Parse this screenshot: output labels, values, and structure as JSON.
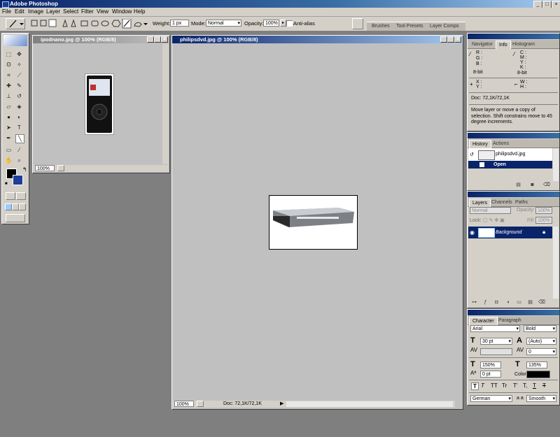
{
  "app": {
    "title": "Adobe Photoshop"
  },
  "menu": [
    "File",
    "Edit",
    "Image",
    "Layer",
    "Select",
    "Filter",
    "View",
    "Window",
    "Help"
  ],
  "options": {
    "weight_label": "Weight:",
    "weight_value": "1 px",
    "mode_label": "Mode:",
    "mode_value": "Normal",
    "opacity_label": "Opacity:",
    "opacity_value": "100%",
    "antialias_label": "Anti-alias",
    "palette_tabs": [
      "Brushes",
      "Tool Presets",
      "Layer Comps"
    ]
  },
  "documents": [
    {
      "title": "ipodnano.jpg @ 100% (RGB/8)",
      "zoom": "100%"
    },
    {
      "title": "philipsdvd.jpg @ 100% (RGB/8)",
      "zoom": "100%",
      "doc_info": "Doc: 72,1K/72,1K"
    }
  ],
  "info_panel": {
    "tabs": [
      "Navigator",
      "Info",
      "Histogram"
    ],
    "rgb_labels": [
      "R :",
      "G :",
      "B :"
    ],
    "cmyk_labels": [
      "C :",
      "M :",
      "Y :",
      "K :"
    ],
    "bitdepth_left": "8-bit",
    "bitdepth_right": "8-bit",
    "xy_labels": [
      "X :",
      "Y :"
    ],
    "wh_labels": [
      "W :",
      "H :"
    ],
    "doc": "Doc: 72,1K/72,1K",
    "hint": "Move layer or move a copy of selection. Shift constrains move to 45 degree increments."
  },
  "history_panel": {
    "tabs": [
      "History",
      "Actions"
    ],
    "snapshot": "philipsdvd.jpg",
    "states": [
      "Open"
    ]
  },
  "layers_panel": {
    "tabs": [
      "Layers",
      "Channels",
      "Paths"
    ],
    "blend_mode": "Normal",
    "opacity_label": "Opacity:",
    "opacity_value": "100%",
    "lock_label": "Lock:",
    "fill_label": "Fill:",
    "fill_value": "100%",
    "layers": [
      "Background"
    ]
  },
  "character_panel": {
    "tabs": [
      "Character",
      "Paragraph"
    ],
    "font": "Arial",
    "style": "Bold",
    "size": "30 pt",
    "leading": "(Auto)",
    "kerning": "",
    "tracking": "0",
    "vscale": "150%",
    "hscale": "135%",
    "baseline": "0 pt",
    "color_label": "Color:",
    "type_buttons": [
      "T",
      "T",
      "TT",
      "Tr",
      "T'",
      "T,",
      "T",
      "T"
    ],
    "language": "German",
    "aa_label": "a a",
    "antialias": "Smooth"
  },
  "colors": {
    "foreground": "#000000",
    "background": "#1f3d99",
    "accent": "#0a246a"
  }
}
